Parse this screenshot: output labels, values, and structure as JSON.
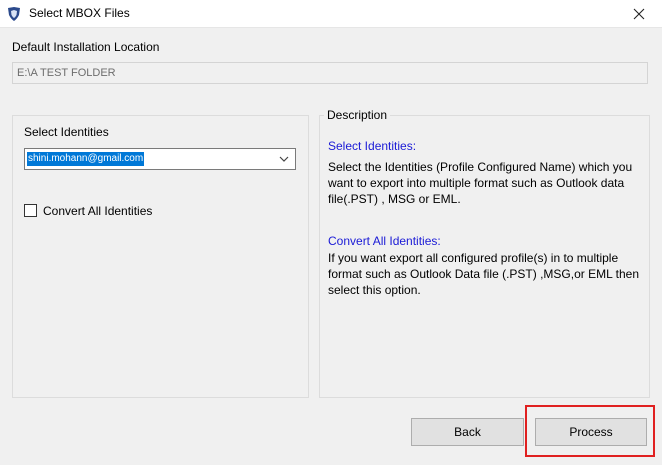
{
  "window": {
    "title": "Select MBOX Files"
  },
  "install": {
    "label": "Default Installation Location",
    "path": "E:\\A TEST FOLDER"
  },
  "identities": {
    "label": "Select Identities",
    "selected": "shini.mohann@gmail.com",
    "convert_all_label": "Convert All Identities",
    "convert_all_checked": false
  },
  "description": {
    "group_label": "Description",
    "select_heading": "Select Identities:",
    "select_text": "Select the Identities (Profile Configured Name) which you want to export into multiple format such as Outlook data file(.PST) , MSG or EML.",
    "convert_heading": "Convert All Identities:",
    "convert_text": "If you want export all configured profile(s) in to multiple format such as Outlook Data file (.PST) ,MSG,or EML then select this option."
  },
  "buttons": {
    "back": "Back",
    "process": "Process"
  },
  "icons": {
    "app": "shield-icon",
    "close": "close-icon",
    "dropdown": "chevron-down-icon"
  },
  "colors": {
    "highlight": "#e02020",
    "link_blue": "#1a1ad6",
    "selection": "#0078d7"
  }
}
